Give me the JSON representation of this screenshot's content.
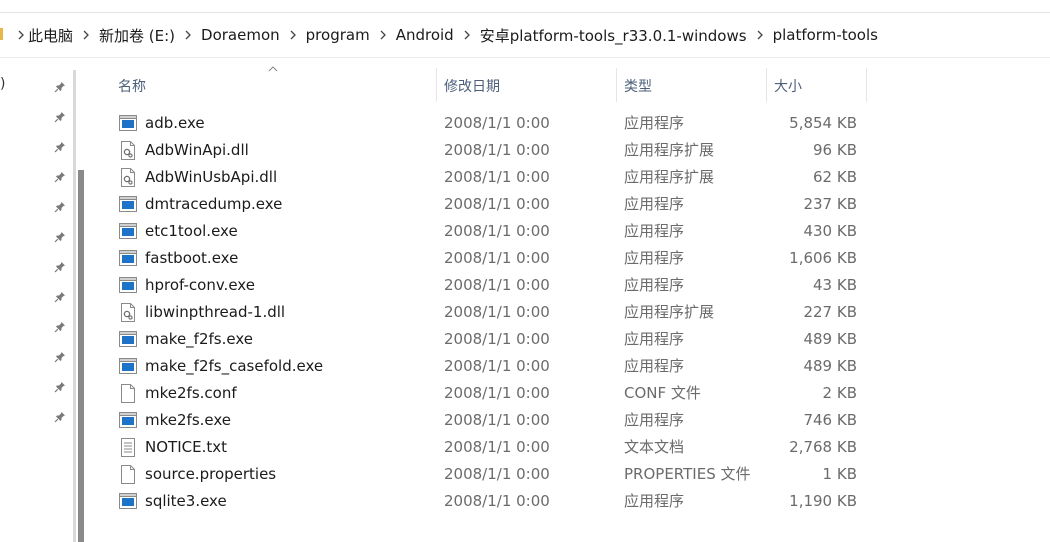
{
  "address_bar": {
    "crumbs": [
      "此电脑",
      "新加卷 (E:)",
      "Doraemon",
      "program",
      "Android",
      "安卓platform-tools_r33.0.1-windows",
      "platform-tools"
    ]
  },
  "nav": {
    "partial_text": ")"
  },
  "columns": {
    "name": "名称",
    "date": "修改日期",
    "type": "类型",
    "size": "大小"
  },
  "files": [
    {
      "name": "adb.exe",
      "date": "2008/1/1 0:00",
      "type": "应用程序",
      "size": "5,854 KB",
      "icon": "exe-icon"
    },
    {
      "name": "AdbWinApi.dll",
      "date": "2008/1/1 0:00",
      "type": "应用程序扩展",
      "size": "96 KB",
      "icon": "dll-icon"
    },
    {
      "name": "AdbWinUsbApi.dll",
      "date": "2008/1/1 0:00",
      "type": "应用程序扩展",
      "size": "62 KB",
      "icon": "dll-icon"
    },
    {
      "name": "dmtracedump.exe",
      "date": "2008/1/1 0:00",
      "type": "应用程序",
      "size": "237 KB",
      "icon": "exe-icon"
    },
    {
      "name": "etc1tool.exe",
      "date": "2008/1/1 0:00",
      "type": "应用程序",
      "size": "430 KB",
      "icon": "exe-icon"
    },
    {
      "name": "fastboot.exe",
      "date": "2008/1/1 0:00",
      "type": "应用程序",
      "size": "1,606 KB",
      "icon": "exe-icon"
    },
    {
      "name": "hprof-conv.exe",
      "date": "2008/1/1 0:00",
      "type": "应用程序",
      "size": "43 KB",
      "icon": "exe-icon"
    },
    {
      "name": "libwinpthread-1.dll",
      "date": "2008/1/1 0:00",
      "type": "应用程序扩展",
      "size": "227 KB",
      "icon": "dll-icon"
    },
    {
      "name": "make_f2fs.exe",
      "date": "2008/1/1 0:00",
      "type": "应用程序",
      "size": "489 KB",
      "icon": "exe-icon"
    },
    {
      "name": "make_f2fs_casefold.exe",
      "date": "2008/1/1 0:00",
      "type": "应用程序",
      "size": "489 KB",
      "icon": "exe-icon"
    },
    {
      "name": "mke2fs.conf",
      "date": "2008/1/1 0:00",
      "type": "CONF 文件",
      "size": "2 KB",
      "icon": "blank-file-icon"
    },
    {
      "name": "mke2fs.exe",
      "date": "2008/1/1 0:00",
      "type": "应用程序",
      "size": "746 KB",
      "icon": "exe-icon"
    },
    {
      "name": "NOTICE.txt",
      "date": "2008/1/1 0:00",
      "type": "文本文档",
      "size": "2,768 KB",
      "icon": "text-file-icon"
    },
    {
      "name": "source.properties",
      "date": "2008/1/1 0:00",
      "type": "PROPERTIES 文件",
      "size": "1 KB",
      "icon": "blank-file-icon"
    },
    {
      "name": "sqlite3.exe",
      "date": "2008/1/1 0:00",
      "type": "应用程序",
      "size": "1,190 KB",
      "icon": "exe-icon"
    }
  ],
  "colors": {
    "header_text": "#4c607a",
    "detail_text": "#6b6b6b",
    "exe_blue": "#1e73c8"
  }
}
